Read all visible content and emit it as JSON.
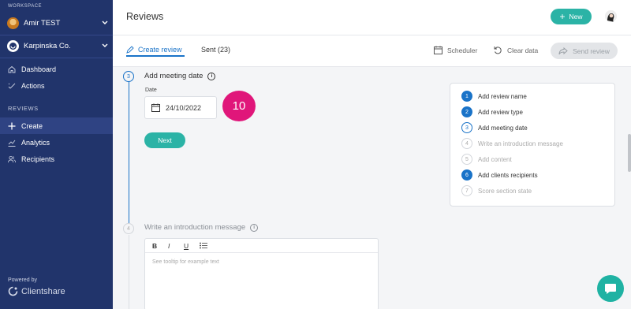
{
  "sidebar": {
    "workspace_label": "WORKSPACE",
    "user_name": "Amir TEST",
    "company_name": "Karpinska Co.",
    "nav": [
      {
        "label": "Dashboard",
        "icon": "home-icon"
      },
      {
        "label": "Actions",
        "icon": "check-icon"
      }
    ],
    "reviews_label": "REVIEWS",
    "reviews_nav": [
      {
        "label": "Create",
        "icon": "plus-icon",
        "active": true
      },
      {
        "label": "Analytics",
        "icon": "chart-icon"
      },
      {
        "label": "Recipients",
        "icon": "users-icon"
      }
    ],
    "powered_by": "Powered by",
    "brand": "Clientshare"
  },
  "header": {
    "title": "Reviews",
    "new_button": "New"
  },
  "tabs": {
    "create": "Create review",
    "sent": "Sent (23)"
  },
  "toolbar": {
    "scheduler": "Scheduler",
    "clear": "Clear data",
    "send": "Send review"
  },
  "step3": {
    "number": "3",
    "title": "Add meeting date",
    "date_label": "Date",
    "date_value": "24/10/2022",
    "badge": "10",
    "next": "Next"
  },
  "step4": {
    "number": "4",
    "title": "Write an introduction message",
    "tools": [
      "B",
      "I",
      "U"
    ],
    "placeholder": "See tooltip for example text"
  },
  "progress_steps": [
    {
      "n": "1",
      "label": "Add review name",
      "state": "done"
    },
    {
      "n": "2",
      "label": "Add review type",
      "state": "done"
    },
    {
      "n": "3",
      "label": "Add meeting date",
      "state": "current"
    },
    {
      "n": "4",
      "label": "Write an introduction message",
      "state": "todo"
    },
    {
      "n": "5",
      "label": "Add content",
      "state": "todo"
    },
    {
      "n": "6",
      "label": "Add clients recipients",
      "state": "done"
    },
    {
      "n": "7",
      "label": "Score section state",
      "state": "todo"
    }
  ],
  "colors": {
    "sidebar": "#21346b",
    "accent": "#2bb3a6",
    "primary": "#1a73c8",
    "badge": "#e0167a"
  }
}
